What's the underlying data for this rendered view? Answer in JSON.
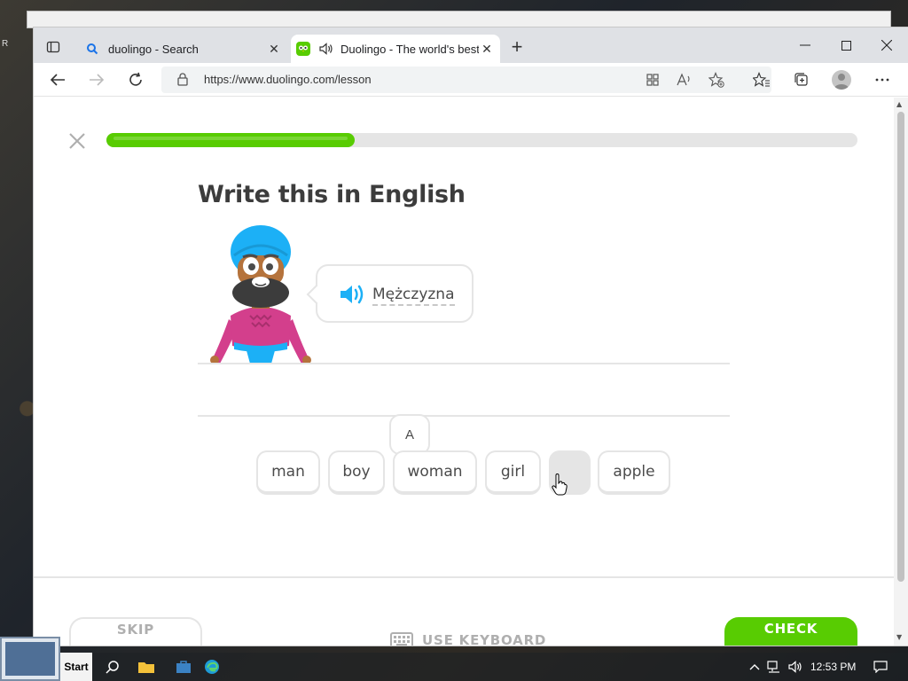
{
  "browser": {
    "tabs": [
      {
        "title": "duolingo - Search",
        "active": false
      },
      {
        "title": "Duolingo - The world's best",
        "active": true
      }
    ],
    "address": {
      "url": "https://www.duolingo.com/lesson"
    }
  },
  "lesson": {
    "progress_fraction": 0.33,
    "heading": "Write this in English",
    "prompt_word": "Mężczyzna",
    "tooltip_letter": "A",
    "word_bank": [
      {
        "label": "man"
      },
      {
        "label": "boy"
      },
      {
        "label": "woman"
      },
      {
        "label": "girl"
      },
      {
        "label": ""
      },
      {
        "label": "apple"
      }
    ]
  },
  "footer": {
    "skip_label": "SKIP",
    "keyboard_label": "USE KEYBOARD",
    "check_label": "CHECK"
  },
  "taskbar": {
    "start_label": "Start",
    "clock": "12:53 PM"
  },
  "colors": {
    "accent_green": "#58cc02",
    "button_border": "#e5e5e5",
    "heading_text": "#3c3c3c",
    "speaker_blue": "#1cb0f6"
  },
  "icons": [
    "sidebar-icon",
    "search-icon",
    "duolingo-owl-icon",
    "speaker-icon",
    "close-icon",
    "plus-icon",
    "back-icon",
    "forward-icon",
    "refresh-icon",
    "lock-icon",
    "app-icon",
    "read-aloud-icon",
    "add-favorite-icon",
    "favorites-icon",
    "collections-icon",
    "more-icon",
    "keyboard-icon",
    "hand-cursor-icon"
  ]
}
